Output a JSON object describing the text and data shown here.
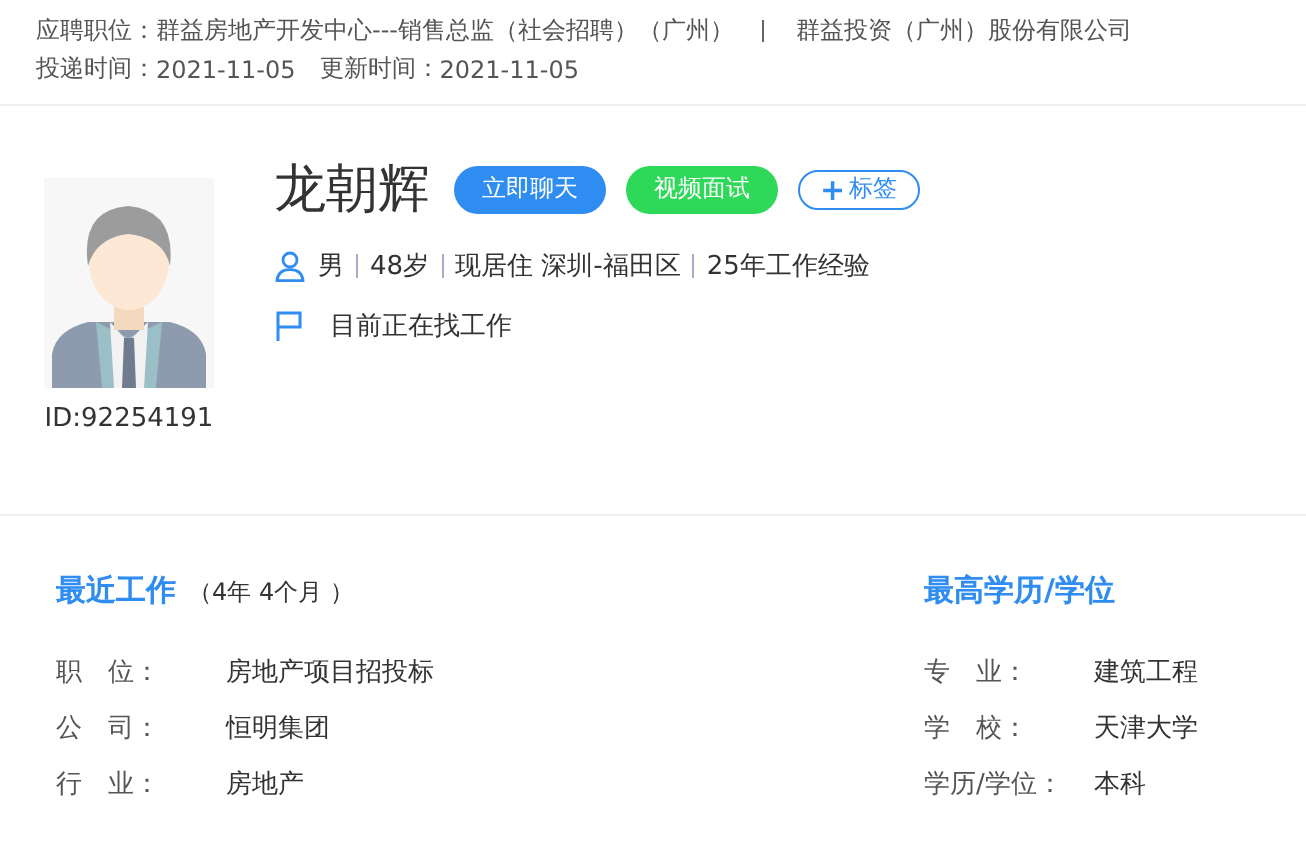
{
  "application": {
    "position_label": "应聘职位：",
    "position": "群益房地产开发中心---销售总监（社会招聘）（广州）",
    "company": "群益投资（广州）股份有限公司",
    "sent_label": "投递时间：",
    "sent": "2021-11-05",
    "updated_label": "更新时间：",
    "updated": "2021-11-05"
  },
  "profile": {
    "id": "ID:92254191",
    "name": "龙朝辉",
    "actions": [
      {
        "kind": "chat",
        "label": "立即聊天"
      },
      {
        "kind": "video",
        "label": "视频面试"
      },
      {
        "kind": "tag",
        "icon": "+",
        "label": "标签"
      }
    ],
    "facts": [
      "男",
      "48岁",
      "现居住 深圳-福田区",
      "25年工作经验"
    ],
    "status": "目前正在找工作"
  },
  "recent_work": {
    "title": "最近工作",
    "duration": "（4年 4个月 ）",
    "rows": [
      {
        "label": "职　位：",
        "value": "房地产项目招投标"
      },
      {
        "label": "公　司：",
        "value": "恒明集团"
      },
      {
        "label": "行　业：",
        "value": "房地产"
      }
    ]
  },
  "education": {
    "title": "最高学历/学位",
    "rows": [
      {
        "label": "专　业：",
        "value": "建筑工程"
      },
      {
        "label": "学　校：",
        "value": "天津大学"
      },
      {
        "label": "学历/学位：",
        "value": "本科"
      }
    ]
  }
}
